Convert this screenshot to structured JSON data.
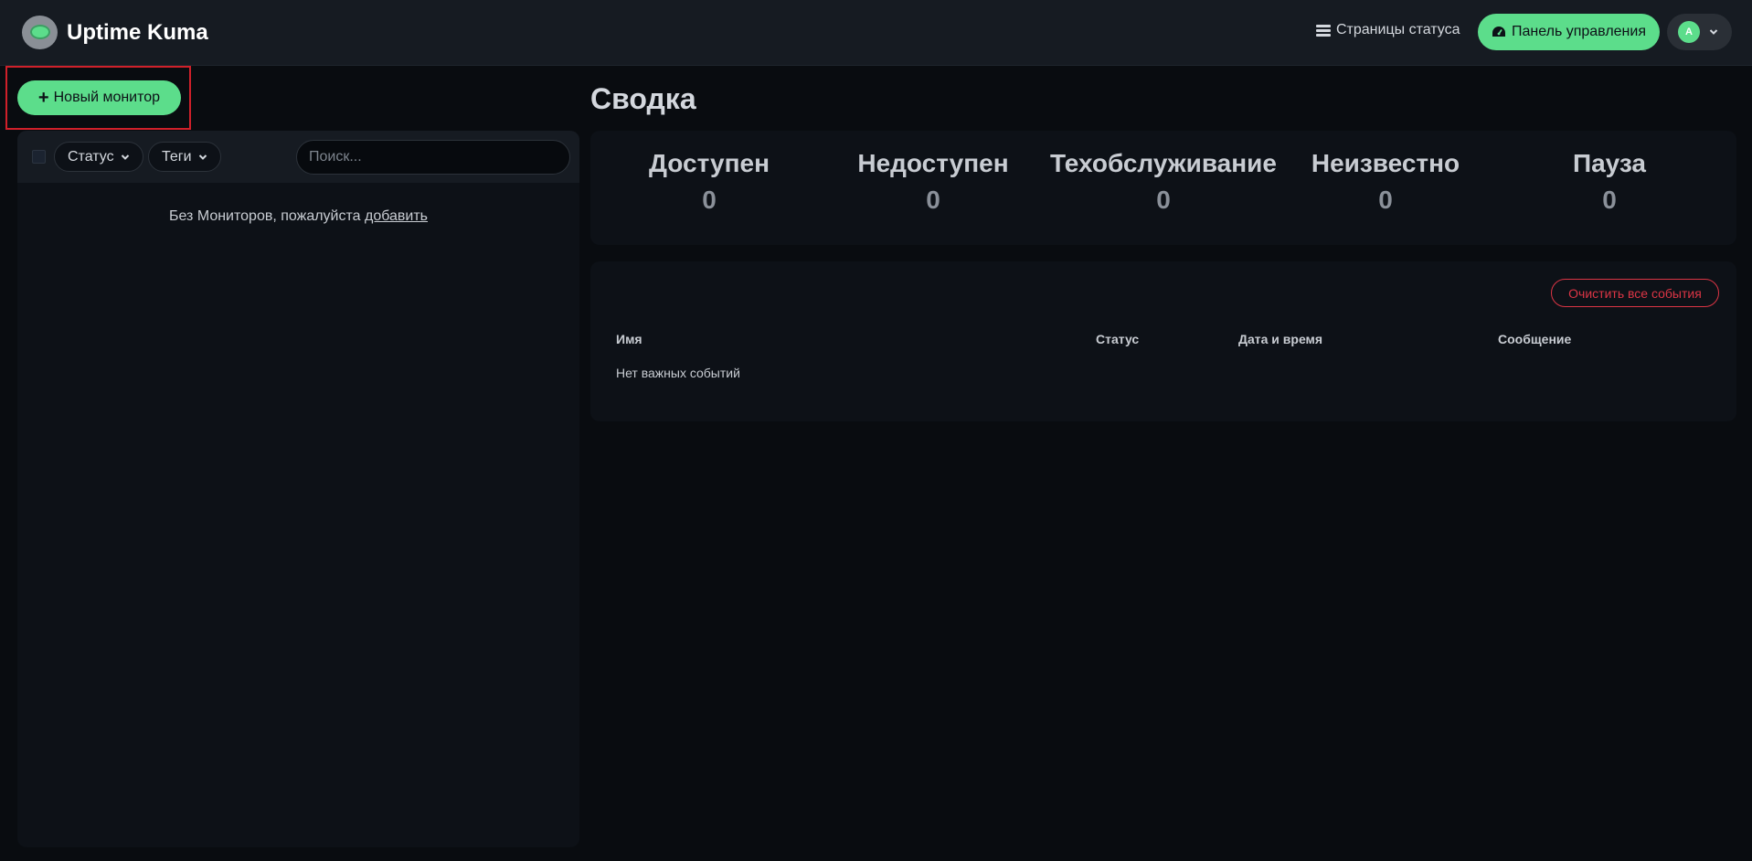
{
  "header": {
    "brand": "Uptime Kuma",
    "status_pages_label": "Страницы статуса",
    "dashboard_label": "Панель управления",
    "avatar_letter": "A",
    "accent_color": "#5cdd8b"
  },
  "sidebar": {
    "new_monitor_label": "Новый монитор",
    "filters": {
      "status_label": "Статус",
      "tags_label": "Теги"
    },
    "search_placeholder": "Поиск...",
    "empty_text": "Без Мониторов, пожалуйста ",
    "empty_link": "добавить"
  },
  "main": {
    "title": "Сводка",
    "stats": [
      {
        "label": "Доступен",
        "value": "0"
      },
      {
        "label": "Недоступен",
        "value": "0"
      },
      {
        "label": "Техобслуживание",
        "value": "0"
      },
      {
        "label": "Неизвестно",
        "value": "0"
      },
      {
        "label": "Пауза",
        "value": "0"
      }
    ],
    "events": {
      "clear_label": "Очистить все события",
      "columns": [
        "Имя",
        "Статус",
        "Дата и время",
        "Сообщение"
      ],
      "empty_text": "Нет важных событий"
    }
  }
}
